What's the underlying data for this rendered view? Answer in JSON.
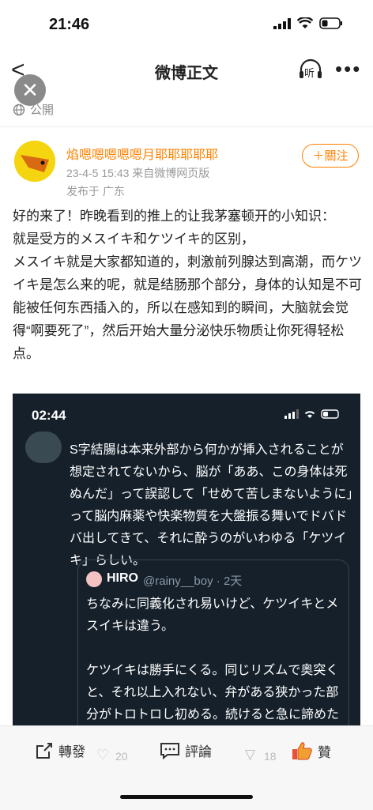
{
  "status_bar": {
    "time": "21:46"
  },
  "nav": {
    "title": "微博正文",
    "listen_label": "听"
  },
  "visibility": {
    "label": "公開"
  },
  "author": {
    "name": "焰嗯嗯嗯嗯嗯月耶耶耶耶耶",
    "date_source": "23-4-5 15:43  来自微博网页版",
    "location": "发布于 广东"
  },
  "follow_label": "＋關注",
  "post": {
    "text": "好的来了！昨晚看到的推上的让我茅塞顿开的小知识：\n就是受方的メスイキ和ケツイキ的区别，\nメスイキ就是大家都知道的，刺激前列腺达到高潮，而ケツイキ是怎么来的呢，就是结肠那个部分，身体的认知是不可能被任何东西插入的，所以在感知到的瞬间，大脑就会觉得“啊要死了”，然后开始大量分泌快乐物质让你死得轻松点。"
  },
  "embedded": {
    "time": "02:44",
    "tweet_text": "S字結腸は本来外部から何かが挿入されることが想定されてないから、脳が「ああ、この身体は死ぬんだ」って誤認して「せめて苦しまないように」って脳内麻薬や快楽物質を大盤振る舞いでドバドバ出してきて、それに酔うのがいわゆる「ケツイキ」らしい。",
    "quote_name": "HIRO",
    "quote_handle": "@rainy__boy · 2天",
    "quote_text": "ちなみに同義化され易いけど、ケツイキとメスイキは違う。\n\nケツイキは勝手にくる。同じリズムで奥突くと、それ以上入れない、弁がある狭かった部分がトロトロし初める。続けると急に諦めたように弁が開いてS字の直前まで亀"
  },
  "bottom_bar": {
    "repost_label": "轉發",
    "comment_label": "評論",
    "like_label": "贊",
    "like_count": "20",
    "share_count": "18"
  },
  "colors": {
    "accent": "#ff8200",
    "embed_bg": "#15202b"
  }
}
